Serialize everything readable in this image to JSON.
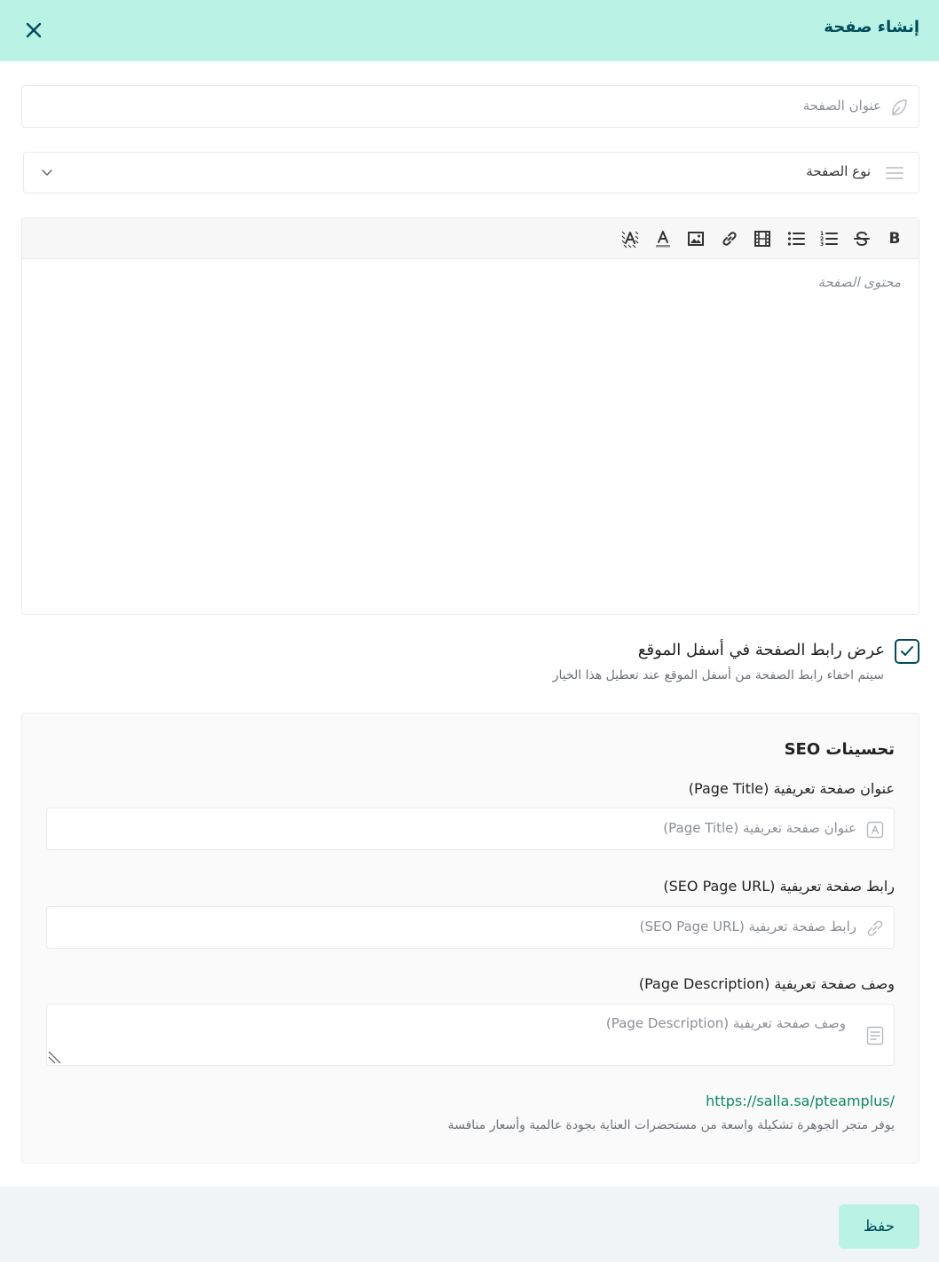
{
  "header": {
    "title": "إنشاء صفحة"
  },
  "page_title_field": {
    "placeholder": "عنوان الصفحة",
    "icon": "feather-icon"
  },
  "page_type_field": {
    "selected": "نوع الصفحة",
    "icon": "menu-lines-icon"
  },
  "editor": {
    "toolbar": [
      "bold",
      "strikethrough",
      "numbered-list",
      "bulleted-list",
      "video",
      "link",
      "image",
      "text-color",
      "clear-format"
    ],
    "bold_label": "B",
    "placeholder": "محتوى الصفحة"
  },
  "footer_link_option": {
    "label": "عرض رابط الصفحة في أسفل الموقع",
    "hint": "سيتم اخفاء رابط الصفحة من أسفل الموقع عند تعطيل هذا الخيار",
    "checked": true
  },
  "seo": {
    "title": "تحسينات SEO",
    "page_title_label": "عنوان صفحة تعريفية (Page Title)",
    "page_title_placeholder": "عنوان صفحة تعريفية (Page Title)",
    "page_url_label": "رابط صفحة تعريفية (SEO Page URL)",
    "page_url_placeholder": "رابط صفحة تعريفية (SEO Page URL)",
    "page_desc_label": "وصف صفحة تعريفية (Page Description)",
    "page_desc_placeholder": "وصف صفحة تعريفية (Page Description)",
    "preview_url": "https://salla.sa/pteamplus/",
    "preview_description": "يوفر متجر الجوهرة تشكيلة واسعة من مستحضرات العناية بجودة عالمية وأسعار منافسة"
  },
  "footer": {
    "save_label": "حفظ"
  },
  "colors": {
    "header_bg": "#baf3e6",
    "primary": "#004d5a",
    "link": "#0a8a5b"
  }
}
